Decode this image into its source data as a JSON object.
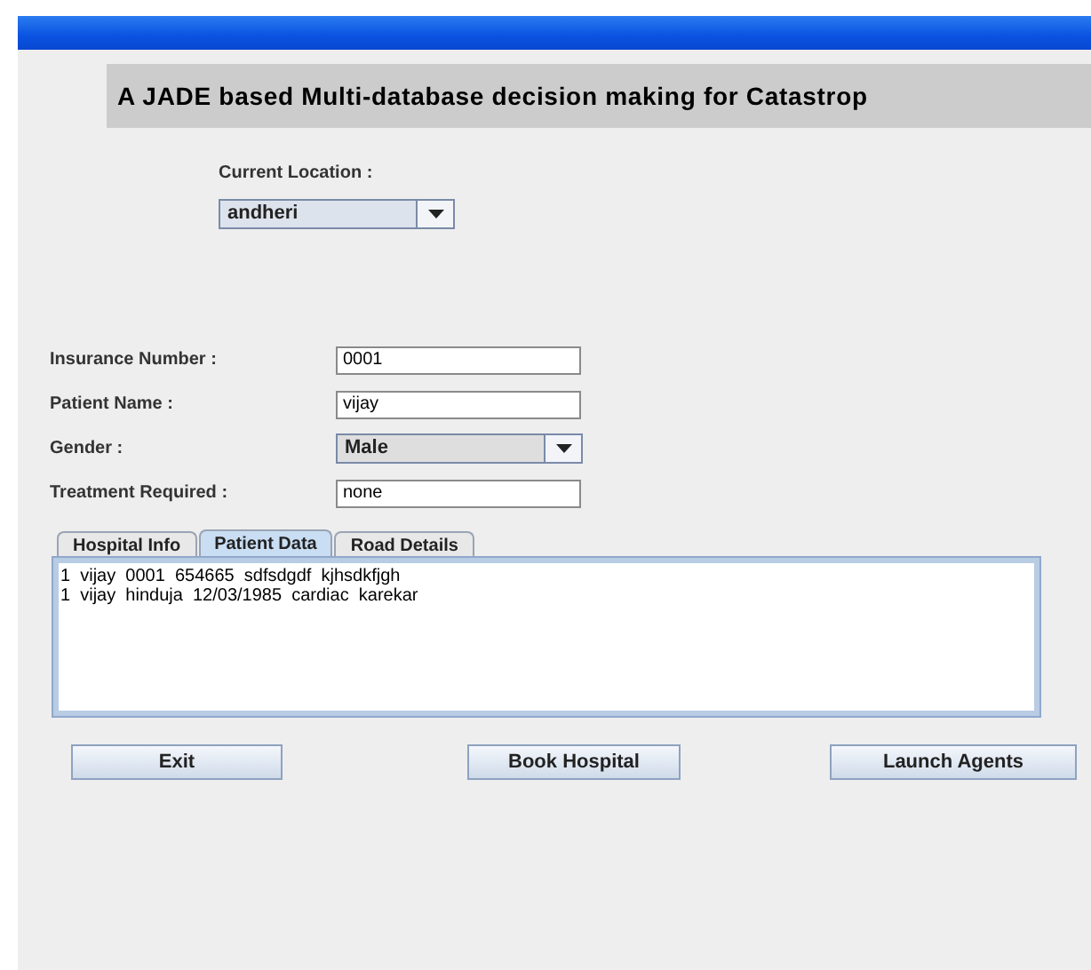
{
  "header": {
    "title": "A JADE based Multi-database decision making for Catastrop"
  },
  "location": {
    "label": "Current Location :",
    "value": "andheri"
  },
  "form": [
    {
      "kind": "text",
      "label": "Insurance Number :",
      "value": "0001"
    },
    {
      "kind": "text",
      "label": "Patient Name :",
      "value": "vijay"
    },
    {
      "kind": "select",
      "label": "Gender :",
      "value": "Male"
    },
    {
      "kind": "text",
      "label": "Treatment Required :",
      "value": "none"
    }
  ],
  "tabs": [
    {
      "label": "Hospital Info",
      "selected": false
    },
    {
      "label": "Patient Data",
      "selected": true
    },
    {
      "label": "Road Details",
      "selected": false
    }
  ],
  "records": [
    "1  vijay  0001  654665  sdfsdgdf  kjhsdkfjgh",
    "1  vijay  hinduja  12/03/1985  cardiac  karekar"
  ],
  "buttons": [
    "Exit",
    "Book Hospital",
    "Launch Agents"
  ]
}
